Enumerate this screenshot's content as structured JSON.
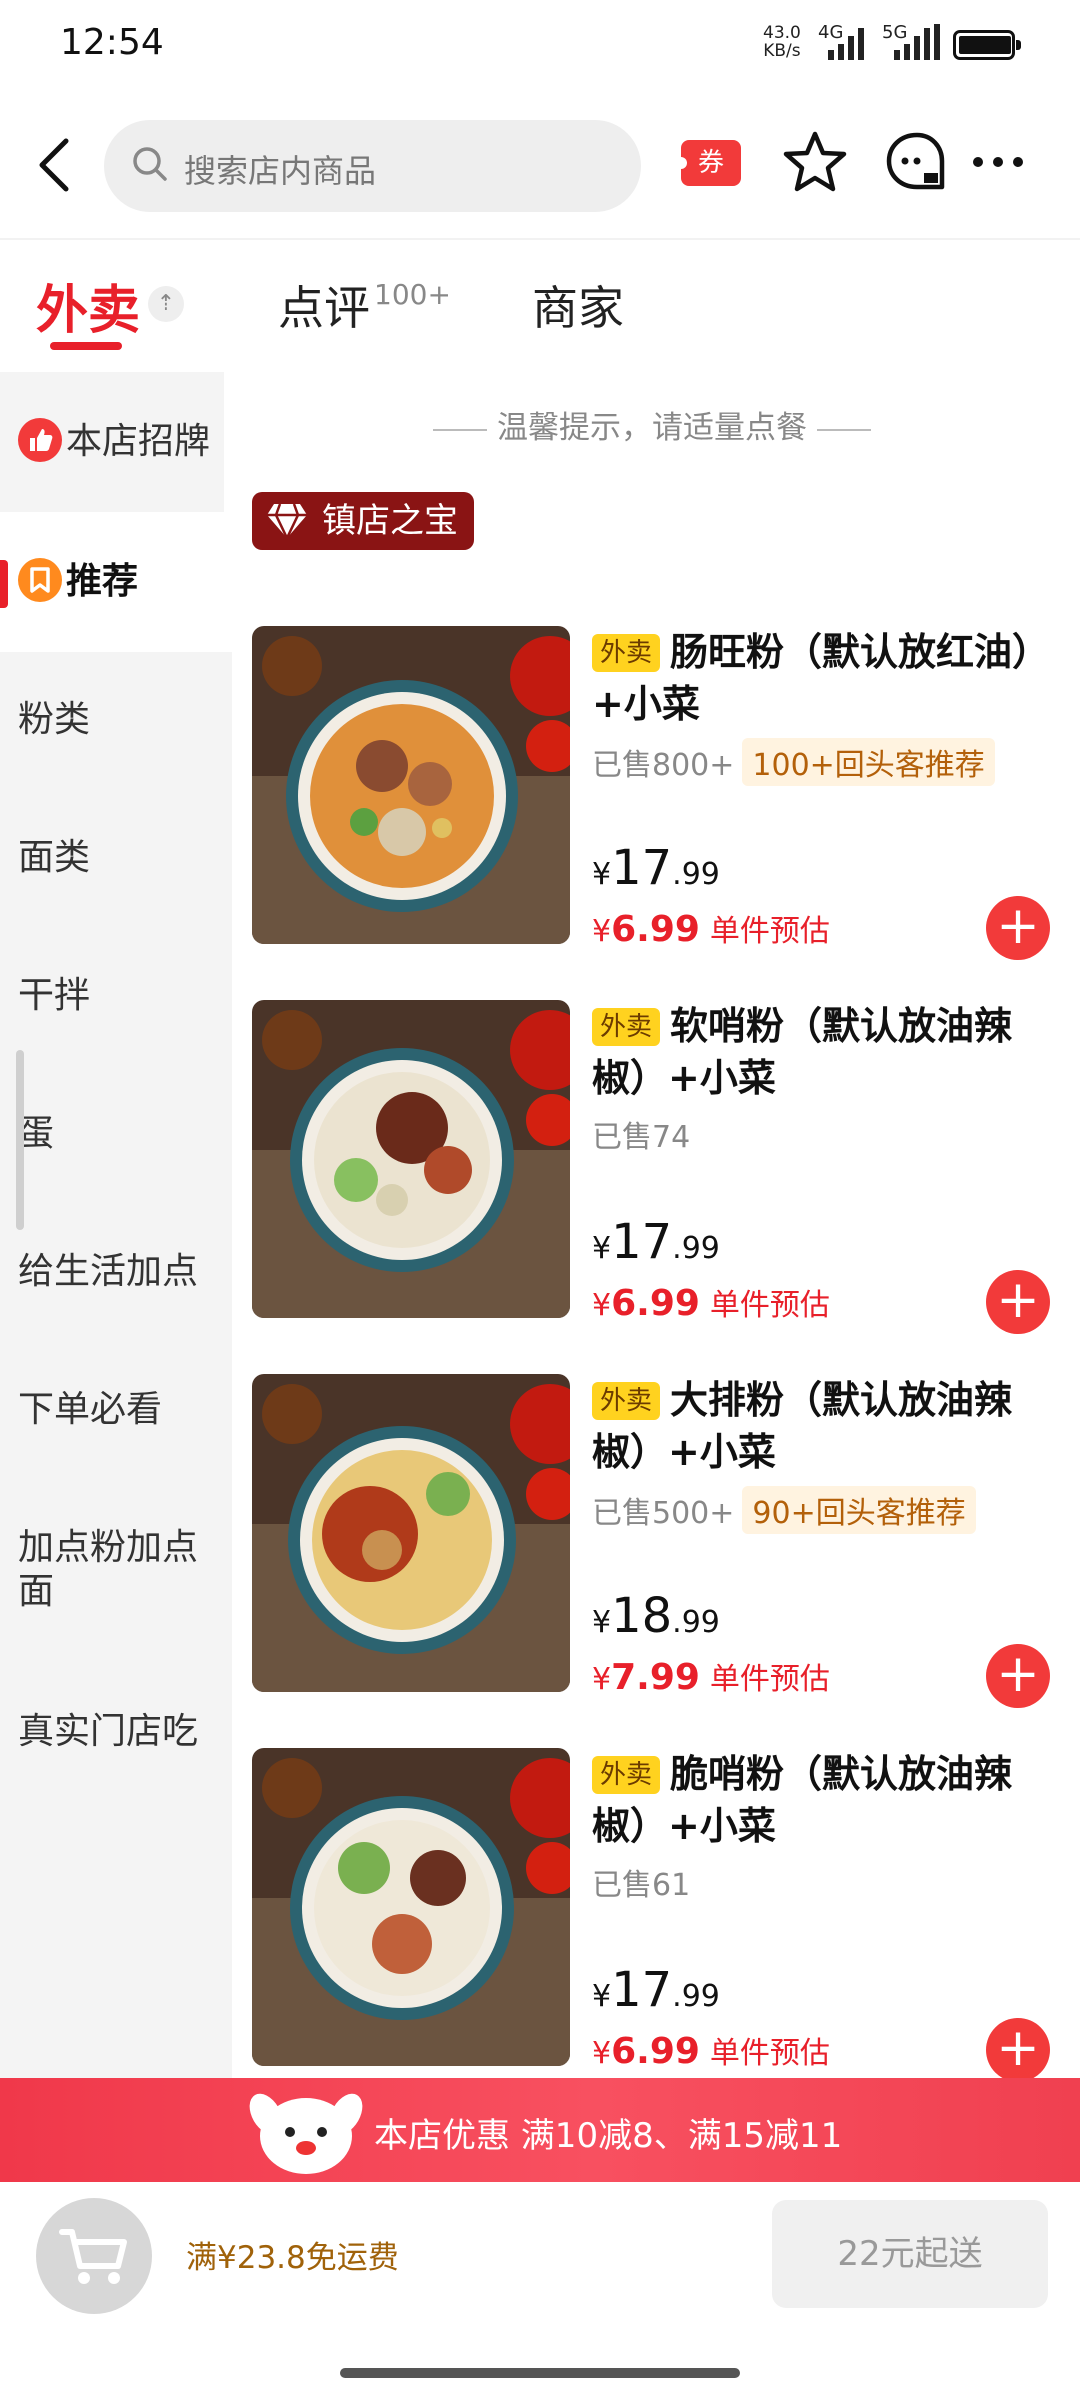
{
  "status_bar": {
    "time": "12:54",
    "net_speed": "43.0",
    "net_unit": "KB/s",
    "net_4g": "4G",
    "net_5g": "5G"
  },
  "header": {
    "search_placeholder": "搜索店内商品",
    "coupon_label": "券",
    "icons": [
      "back-arrow-icon",
      "search-icon",
      "coupon-icon",
      "star-icon",
      "chat-icon",
      "more-icon"
    ]
  },
  "tabs": [
    {
      "label": "外卖",
      "active": true
    },
    {
      "label": "点评",
      "count": "100+"
    },
    {
      "label": "商家"
    }
  ],
  "sidebar": {
    "items": [
      {
        "label": "本店招牌",
        "icon": "thumbs-up-icon"
      },
      {
        "label": "推荐",
        "icon": "bookmark-icon",
        "selected": true
      },
      {
        "label": "粉类"
      },
      {
        "label": "面类"
      },
      {
        "label": "干拌"
      },
      {
        "label": "蛋"
      },
      {
        "label": "给生活加点"
      },
      {
        "label": "下单必看"
      },
      {
        "label": "加点粉加点面"
      },
      {
        "label": "真实门店吃"
      }
    ]
  },
  "content": {
    "tip": "温馨提示，请适量点餐",
    "section_badge": "镇店之宝",
    "items": [
      {
        "tag": "外卖",
        "title": "肠旺粉（默认放红油）+小菜",
        "sold": "已售800+",
        "rec": "100+回头客推荐",
        "price_int": "17",
        "price_dec": ".99",
        "deal_int": "6.99",
        "deal_label": "单件预估",
        "currency": "¥"
      },
      {
        "tag": "外卖",
        "title": "软哨粉（默认放油辣椒）+小菜",
        "sold": "已售74",
        "rec": "",
        "price_int": "17",
        "price_dec": ".99",
        "deal_int": "6.99",
        "deal_label": "单件预估",
        "currency": "¥"
      },
      {
        "tag": "外卖",
        "title": "大排粉（默认放油辣椒）+小菜",
        "sold": "已售500+",
        "rec": "90+回头客推荐",
        "price_int": "18",
        "price_dec": ".99",
        "deal_int": "7.99",
        "deal_label": "单件预估",
        "currency": "¥"
      },
      {
        "tag": "外卖",
        "title": "脆哨粉（默认放油辣椒）+小菜",
        "sold": "已售61",
        "rec": "",
        "price_int": "17",
        "price_dec": ".99",
        "deal_int": "6.99",
        "deal_label": "单件预估",
        "currency": "¥"
      }
    ]
  },
  "promo": {
    "text": "本店优惠  满10减8、满15减11"
  },
  "bottom": {
    "free_delivery": "满¥23.8免运费",
    "min_order": "22元起送"
  },
  "colors": {
    "accent": "#e8202a",
    "add_button": "#f23a3a",
    "tag_yellow": "#ffd21f",
    "treasure_badge": "#8a1414"
  }
}
